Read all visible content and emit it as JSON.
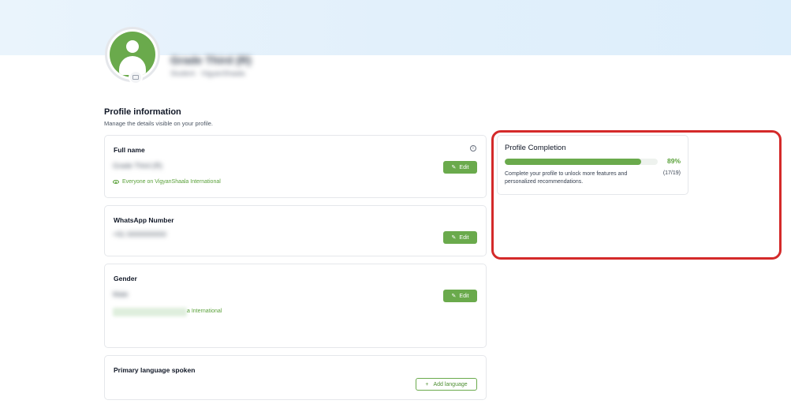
{
  "header": {
    "user_name": "Grade Third (R)",
    "user_subtitle": "Student · VigyanShaala"
  },
  "profile": {
    "title": "Profile information",
    "subtitle": "Manage the details visible on your profile."
  },
  "full_name": {
    "label": "Full name",
    "value": "Grade Third (R)",
    "visibility": "Everyone on VigyanShaala International",
    "edit_label": "Edit"
  },
  "whatsapp": {
    "label": "WhatsApp Number",
    "value": "+91 0000000000",
    "edit_label": "Edit"
  },
  "gender": {
    "label": "Gender",
    "value": "Male",
    "visibility_partial": "a International",
    "edit_label": "Edit"
  },
  "language": {
    "label": "Primary language spoken",
    "add_label": "Add language",
    "add_icon": "+"
  },
  "completion": {
    "title": "Profile Completion",
    "percent_label": "89%",
    "fraction": 0.89,
    "description": "Complete your profile to unlock more features and personalized recommendations.",
    "count": "(17/19)"
  },
  "icons": {
    "edit": "✎",
    "info": "i"
  },
  "colors": {
    "accent": "#6aaa4c",
    "highlight": "#d42a2a"
  }
}
